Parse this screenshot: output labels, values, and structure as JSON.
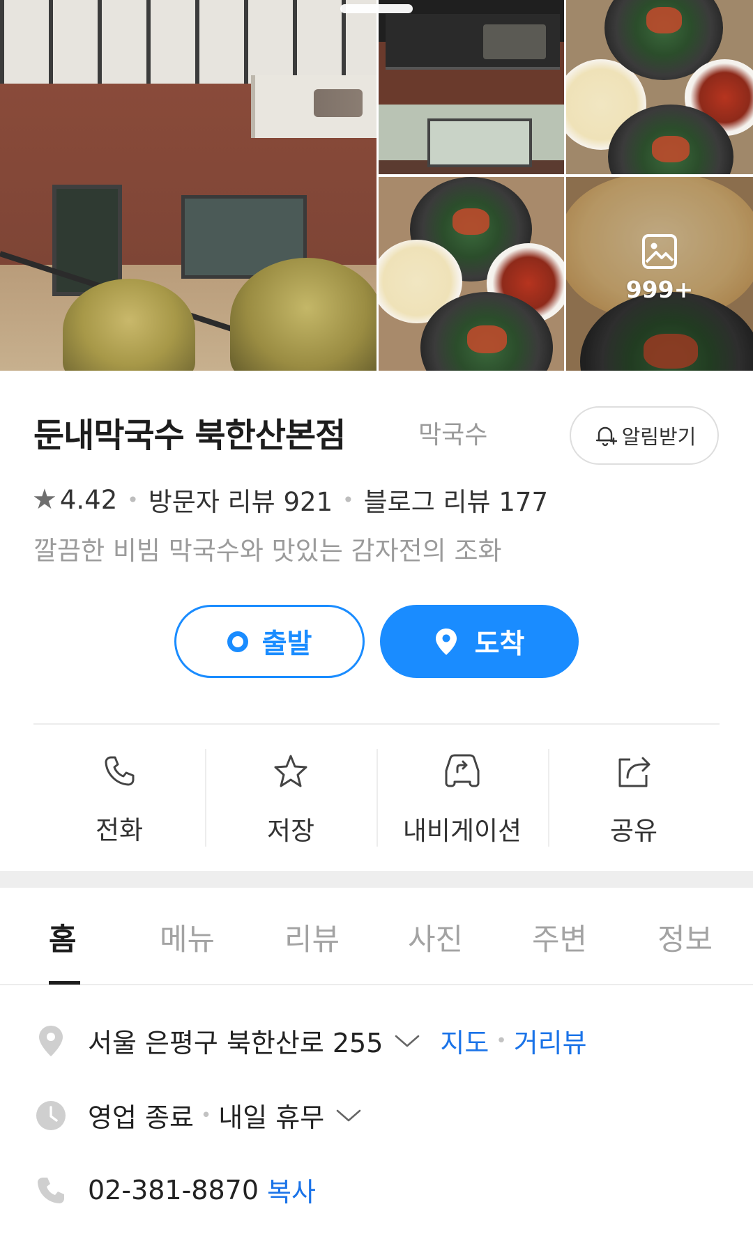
{
  "gallery": {
    "more_count": "999+"
  },
  "place": {
    "name": "둔내막국수 북한산본점",
    "category": "막국수",
    "alert_label": "알림받기",
    "rating": "4.42",
    "visitor_reviews": "방문자 리뷰 921",
    "blog_reviews": "블로그 리뷰 177",
    "summary": "깔끔한 비빔 막국수와 맛있는 감자전의 조화"
  },
  "route": {
    "depart_label": "출발",
    "arrive_label": "도착"
  },
  "actions": [
    {
      "label": "전화",
      "icon": "phone-icon"
    },
    {
      "label": "저장",
      "icon": "star-icon"
    },
    {
      "label": "내비게이션",
      "icon": "car-navigation-icon"
    },
    {
      "label": "공유",
      "icon": "share-icon"
    }
  ],
  "tabs": [
    {
      "label": "홈",
      "active": true
    },
    {
      "label": "메뉴"
    },
    {
      "label": "리뷰"
    },
    {
      "label": "사진"
    },
    {
      "label": "주변"
    },
    {
      "label": "정보"
    }
  ],
  "info": {
    "address": "서울 은평구 북한산로 255",
    "map_link": "지도",
    "street_view_link": "거리뷰",
    "hours_status": "영업 종료",
    "hours_next": "내일 휴무",
    "phone": "02-381-8870",
    "copy_label": "복사"
  },
  "colors": {
    "accent": "#1a8cff",
    "link": "#1a73e8",
    "muted": "#9b9b9b"
  }
}
